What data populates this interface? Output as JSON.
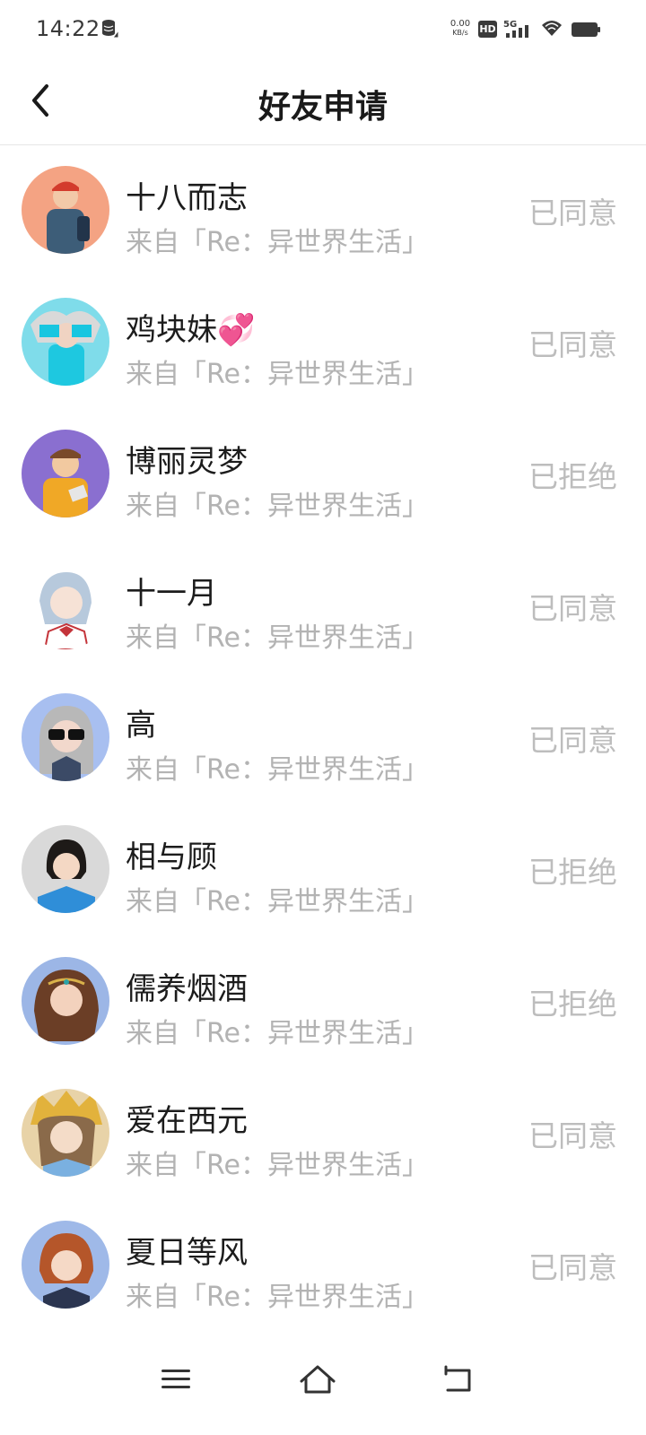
{
  "status_bar": {
    "time": "14:22",
    "speed_value": "0.00",
    "speed_unit": "KB/s",
    "hd_label": "HD",
    "network_label": "5G"
  },
  "header": {
    "title": "好友申请",
    "back_icon": "chevron-left-icon"
  },
  "requests": [
    {
      "name": "十八而志",
      "source": "来自「Re：异世界生活」",
      "status": "已同意",
      "avatar_bg": "#f4a383"
    },
    {
      "name": "鸡块妹💞",
      "source": "来自「Re：异世界生活」",
      "status": "已同意",
      "avatar_bg": "#7fdcea"
    },
    {
      "name": "博丽灵梦",
      "source": "来自「Re：异世界生活」",
      "status": "已拒绝",
      "avatar_bg": "#8a6fd0"
    },
    {
      "name": "十一月",
      "source": "来自「Re：异世界生活」",
      "status": "已同意",
      "avatar_bg": "#ffffff"
    },
    {
      "name": "高",
      "source": "来自「Re：异世界生活」",
      "status": "已同意",
      "avatar_bg": "#a8bff0"
    },
    {
      "name": "相与顾",
      "source": "来自「Re：异世界生活」",
      "status": "已拒绝",
      "avatar_bg": "#d9d9d9"
    },
    {
      "name": "儒养烟酒",
      "source": "来自「Re：异世界生活」",
      "status": "已拒绝",
      "avatar_bg": "#9cb6e6"
    },
    {
      "name": "爱在西元",
      "source": "来自「Re：异世界生活」",
      "status": "已同意",
      "avatar_bg": "#e8d3a8"
    },
    {
      "name": "夏日等风",
      "source": "来自「Re：异世界生活」",
      "status": "已同意",
      "avatar_bg": "#9fb9e8"
    }
  ],
  "nav_bar": {
    "icons": [
      "menu-icon",
      "home-icon",
      "back-icon"
    ]
  },
  "colors": {
    "title": "#1a1a1a",
    "name": "#1c1c1c",
    "secondary": "#b3b3b3",
    "status": "#bdbdbd",
    "divider": "#e6e6e6"
  }
}
